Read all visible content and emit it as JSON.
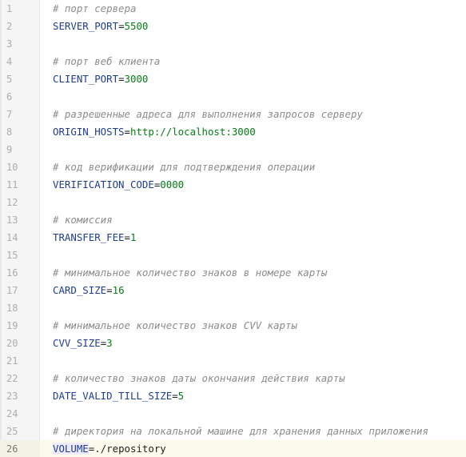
{
  "editor": {
    "lines": [
      {
        "n": "1",
        "type": "comment",
        "text": "# порт сервера"
      },
      {
        "n": "2",
        "type": "kv",
        "key": "SERVER_PORT",
        "value": "5500",
        "vclass": "val"
      },
      {
        "n": "3",
        "type": "empty"
      },
      {
        "n": "4",
        "type": "comment",
        "text": "# порт веб клиента"
      },
      {
        "n": "5",
        "type": "kv",
        "key": "CLIENT_PORT",
        "value": "3000",
        "vclass": "val"
      },
      {
        "n": "6",
        "type": "empty"
      },
      {
        "n": "7",
        "type": "comment",
        "text": "# разрешенные адреса для выполнения запросов серверу"
      },
      {
        "n": "8",
        "type": "kv",
        "key": "ORIGIN_HOSTS",
        "value": "http://localhost:3000",
        "vclass": "val"
      },
      {
        "n": "9",
        "type": "empty"
      },
      {
        "n": "10",
        "type": "comment",
        "text": "# код верификации для подтверждения операции"
      },
      {
        "n": "11",
        "type": "kv",
        "key": "VERIFICATION_CODE",
        "value": "0000",
        "vclass": "val"
      },
      {
        "n": "12",
        "type": "empty"
      },
      {
        "n": "13",
        "type": "comment",
        "text": "# комиссия"
      },
      {
        "n": "14",
        "type": "kv",
        "key": "TRANSFER_FEE",
        "value": "1",
        "vclass": "val"
      },
      {
        "n": "15",
        "type": "empty"
      },
      {
        "n": "16",
        "type": "comment",
        "text": "# минимальное количество знаков в номере карты"
      },
      {
        "n": "17",
        "type": "kv",
        "key": "CARD_SIZE",
        "value": "16",
        "vclass": "val"
      },
      {
        "n": "18",
        "type": "empty"
      },
      {
        "n": "19",
        "type": "comment",
        "text": "# минимальное количество знаков CVV карты"
      },
      {
        "n": "20",
        "type": "kv",
        "key": "CVV_SIZE",
        "value": "3",
        "vclass": "val"
      },
      {
        "n": "21",
        "type": "empty"
      },
      {
        "n": "22",
        "type": "comment",
        "text": "# количество знаков даты окончания действия карты"
      },
      {
        "n": "23",
        "type": "kv",
        "key": "DATE_VALID_TILL_SIZE",
        "value": "5",
        "vclass": "val"
      },
      {
        "n": "24",
        "type": "empty"
      },
      {
        "n": "25",
        "type": "comment",
        "text": "# директория на локальной машине для хранения данных приложения"
      },
      {
        "n": "26",
        "type": "kv",
        "key": "VOLUME",
        "value": "./repository",
        "vclass": "val-path",
        "current": true,
        "caret": true
      }
    ],
    "equals": "="
  }
}
